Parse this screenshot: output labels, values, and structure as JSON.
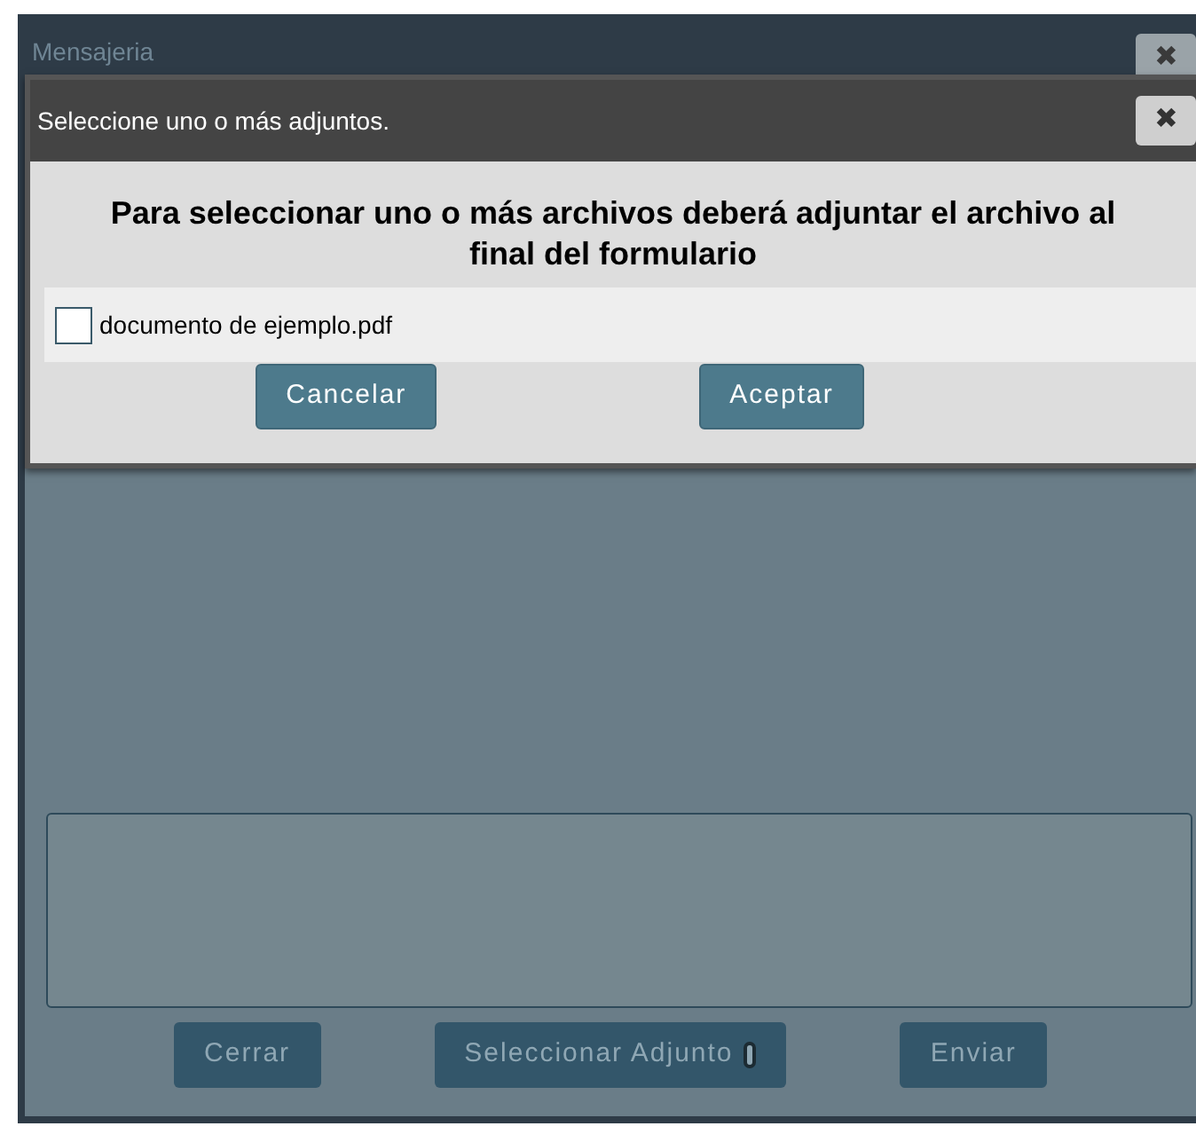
{
  "window": {
    "title": "Mensajeria",
    "close": "✖"
  },
  "buttons": [
    {
      "label": "Cerrar",
      "icon": false
    },
    {
      "label": "Seleccionar Adjunto",
      "icon": true
    },
    {
      "label": "Enviar",
      "icon": false
    }
  ],
  "dialog": {
    "title": "Seleccione uno o más adjuntos.",
    "close": "✖",
    "heading": "Para seleccionar uno o más archivos deberá adjuntar el archivo al final del formulario",
    "files": [
      {
        "name": "documento de ejemplo.pdf",
        "checked": false
      }
    ],
    "buttons": [
      "Cancelar",
      "Aceptar"
    ]
  }
}
